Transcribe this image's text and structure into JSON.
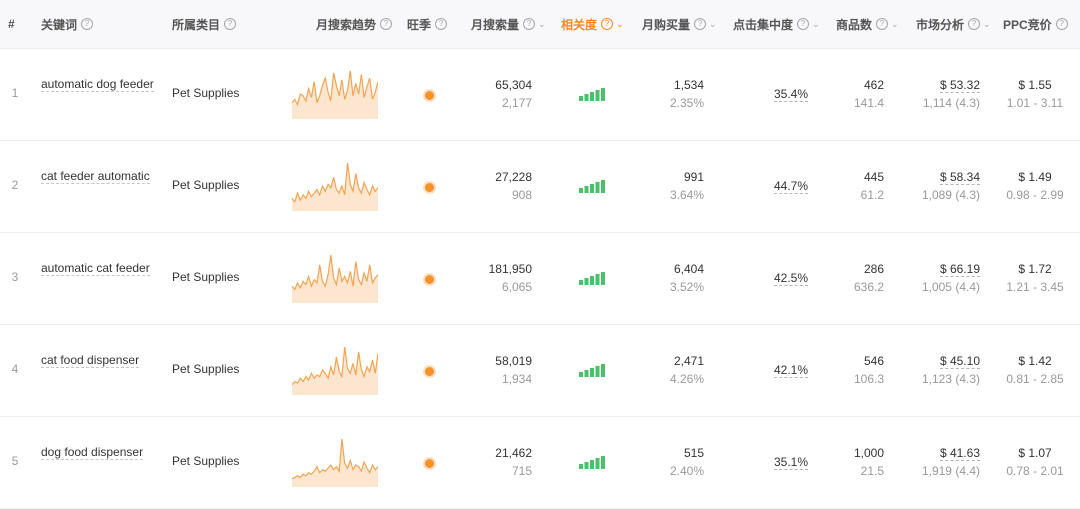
{
  "header": {
    "index": "#",
    "keyword": "关键词",
    "category": "所属类目",
    "trend": "月搜索趋势",
    "season": "旺季",
    "volume": "月搜索量",
    "relevance": "相关度",
    "purchases": "月购买量",
    "click_concentration": "点击集中度",
    "products": "商品数",
    "market": "市场分析",
    "ppc": "PPC竞价",
    "help_glyph": "?",
    "caret_glyph": "⌄"
  },
  "colors": {
    "accent": "#f38a2a",
    "trend_line": "#f3a452",
    "trend_fill": "#fde6cf",
    "relevance_bar": "#4cbf6a"
  },
  "rows": [
    {
      "index": "1",
      "keyword": "automatic dog feeder",
      "category": "Pet Supplies",
      "volume": "65,304",
      "volume_sub": "2,177",
      "relevance_level": 5,
      "purchases": "1,534",
      "purchases_rate": "2.35%",
      "click": "35.4%",
      "products": "462",
      "products_sub": "141.4",
      "price": "$ 53.32",
      "reviews": "1,114 (4.3)",
      "ppc": "$ 1.55",
      "ppc_range": "1.01 - 3.11",
      "trend": [
        8,
        10,
        7,
        13,
        12,
        9,
        16,
        11,
        20,
        8,
        12,
        18,
        22,
        14,
        9,
        25,
        18,
        12,
        21,
        10,
        15,
        26,
        12,
        19,
        13,
        24,
        11,
        17,
        22,
        10,
        14,
        20
      ]
    },
    {
      "index": "2",
      "keyword": "cat feeder automatic",
      "category": "Pet Supplies",
      "volume": "27,228",
      "volume_sub": "908",
      "relevance_level": 5,
      "purchases": "991",
      "purchases_rate": "3.64%",
      "click": "44.7%",
      "products": "445",
      "products_sub": "61.2",
      "price": "$ 58.34",
      "reviews": "1,089 (4.3)",
      "ppc": "$ 1.49",
      "ppc_range": "0.98 - 2.99",
      "trend": [
        6,
        4,
        9,
        5,
        8,
        6,
        10,
        7,
        9,
        11,
        8,
        13,
        10,
        14,
        12,
        18,
        11,
        9,
        13,
        8,
        26,
        14,
        10,
        20,
        12,
        9,
        15,
        11,
        8,
        13,
        10,
        12
      ]
    },
    {
      "index": "3",
      "keyword": "automatic cat feeder",
      "category": "Pet Supplies",
      "volume": "181,950",
      "volume_sub": "6,065",
      "relevance_level": 5,
      "purchases": "6,404",
      "purchases_rate": "3.52%",
      "click": "42.5%",
      "products": "286",
      "products_sub": "636.2",
      "price": "$ 66.19",
      "reviews": "1,005 (4.4)",
      "ppc": "$ 1.72",
      "ppc_range": "1.21 - 3.45",
      "trend": [
        9,
        7,
        11,
        8,
        12,
        10,
        15,
        9,
        13,
        11,
        22,
        12,
        9,
        16,
        28,
        14,
        10,
        20,
        12,
        15,
        11,
        18,
        9,
        24,
        13,
        10,
        17,
        12,
        22,
        11,
        14,
        16
      ]
    },
    {
      "index": "4",
      "keyword": "cat food dispenser",
      "category": "Pet Supplies",
      "volume": "58,019",
      "volume_sub": "1,934",
      "relevance_level": 5,
      "purchases": "2,471",
      "purchases_rate": "4.26%",
      "click": "42.1%",
      "products": "546",
      "products_sub": "106.3",
      "price": "$ 45.10",
      "reviews": "1,123 (4.3)",
      "ppc": "$ 1.42",
      "ppc_range": "0.81 - 2.85",
      "trend": [
        5,
        7,
        6,
        9,
        7,
        10,
        8,
        12,
        9,
        11,
        10,
        14,
        12,
        9,
        16,
        11,
        22,
        13,
        10,
        28,
        15,
        12,
        18,
        11,
        25,
        14,
        10,
        16,
        13,
        20,
        12,
        24
      ]
    },
    {
      "index": "5",
      "keyword": "dog food dispenser",
      "category": "Pet Supplies",
      "volume": "21,462",
      "volume_sub": "715",
      "relevance_level": 5,
      "purchases": "515",
      "purchases_rate": "2.40%",
      "click": "35.1%",
      "products": "1,000",
      "products_sub": "21.5",
      "price": "$ 41.63",
      "reviews": "1,919 (4.4)",
      "ppc": "$ 1.07",
      "ppc_range": "0.78 - 2.01",
      "trend": [
        4,
        5,
        6,
        5,
        7,
        6,
        8,
        7,
        9,
        12,
        8,
        10,
        9,
        11,
        13,
        10,
        12,
        9,
        30,
        14,
        11,
        16,
        10,
        13,
        12,
        9,
        15,
        11,
        8,
        13,
        10,
        12
      ]
    }
  ]
}
